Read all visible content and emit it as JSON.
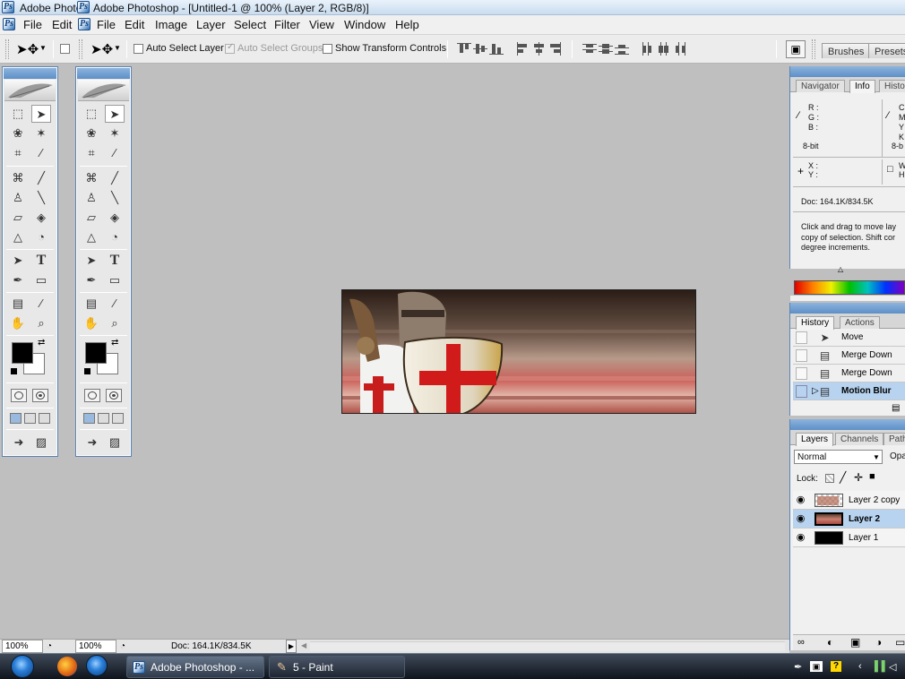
{
  "titlebar": {
    "left_title": "Adobe Photo",
    "main_title": "Adobe Photoshop - [Untitled-1 @ 100% (Layer 2, RGB/8)]"
  },
  "menubar": {
    "left_items": [
      "File",
      "Edit"
    ],
    "items": [
      "File",
      "Edit",
      "Image",
      "Layer",
      "Select",
      "Filter",
      "View",
      "Window",
      "Help"
    ]
  },
  "options": {
    "auto_select_layer": "Auto Select Layer",
    "auto_select_groups": "Auto Select Groups",
    "show_transform_controls": "Show Transform Controls",
    "auto_select_groups_checked": true,
    "tab_brushes": "Brushes",
    "tab_presets": "Presets"
  },
  "canvas": {
    "description_colors": {
      "shield": "#e9e4d6",
      "cross": "#d11a1a",
      "blur_dark": "#3a2a20",
      "blur_red": "#c9605a"
    }
  },
  "info_panel": {
    "tabs": [
      "Navigator",
      "Info",
      "Histo"
    ],
    "active_tab": "Info",
    "r_label": "R :",
    "g_label": "G :",
    "b_label": "B :",
    "bit_left": "8-bit",
    "bit_right": "8-b",
    "cmyk_c": "C",
    "cmyk_m": "M",
    "cmyk_y": "Y",
    "cmyk_k": "K",
    "x_label": "X :",
    "y_label": "Y :",
    "w_label": "W",
    "h_label": "H",
    "doc": "Doc: 164.1K/834.5K",
    "help_line1": "Click and drag to move lay",
    "help_line2": "copy of selection. Shift cor",
    "help_line3": "degree increments."
  },
  "history_panel": {
    "tabs": [
      "History",
      "Actions"
    ],
    "active_tab": "History",
    "items": [
      {
        "label": "Move",
        "icon": "move-tool-icon"
      },
      {
        "label": "Merge Down",
        "icon": "history-state-icon"
      },
      {
        "label": "Merge Down",
        "icon": "history-state-icon"
      },
      {
        "label": "Motion Blur",
        "icon": "history-state-icon",
        "selected": true
      }
    ]
  },
  "layers_panel": {
    "tabs": [
      "Layers",
      "Channels",
      "Path"
    ],
    "active_tab": "Layers",
    "blend_mode": "Normal",
    "opacity_label": "Opa",
    "lock_label": "Lock:",
    "layers": [
      {
        "name": "Layer 2 copy",
        "selected": false
      },
      {
        "name": "Layer 2",
        "selected": true
      },
      {
        "name": "Layer 1",
        "selected": false
      }
    ]
  },
  "status": {
    "zoom_left": "100%",
    "zoom_right": "100%",
    "doc": "Doc: 164.1K/834.5K"
  },
  "taskbar": {
    "buttons": [
      "Adobe Photoshop - ...",
      "5 - Paint"
    ]
  }
}
